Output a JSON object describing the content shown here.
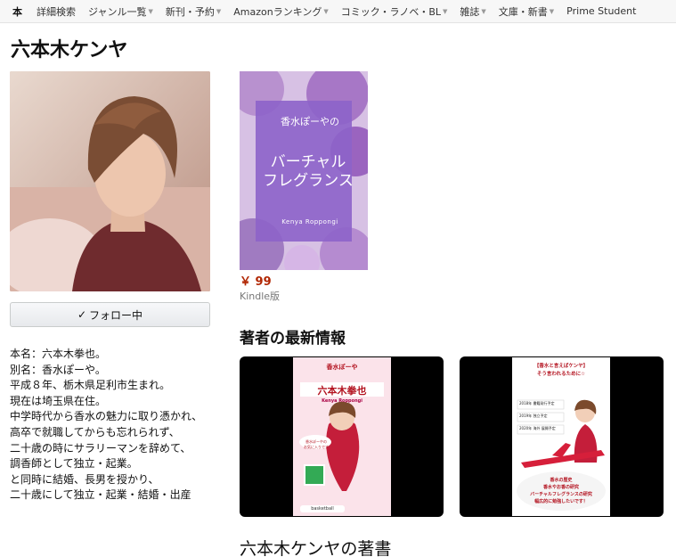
{
  "nav": {
    "items": [
      {
        "label": "本",
        "caret": false
      },
      {
        "label": "詳細検索",
        "caret": false
      },
      {
        "label": "ジャンル一覧",
        "caret": true
      },
      {
        "label": "新刊・予約",
        "caret": true
      },
      {
        "label": "Amazonランキング",
        "caret": true
      },
      {
        "label": "コミック・ラノベ・BL",
        "caret": true
      },
      {
        "label": "雑誌",
        "caret": true
      },
      {
        "label": "文庫・新書",
        "caret": true
      },
      {
        "label": "Prime Student",
        "caret": false
      }
    ]
  },
  "author": {
    "name": "六本木ケンヤ",
    "follow_label": "フォロー中",
    "bio_lines": [
      "本名：六本木拳也。",
      "別名：香水ぽーや。",
      "",
      "平成８年、栃木県足利市生まれ。",
      "現在は埼玉県在住。",
      "",
      "中学時代から香水の魅力に取り憑かれ、",
      "高卒で就職してからも忘れられず、",
      "二十歳の時にサラリーマンを辞めて、",
      "調香師として独立・起業。",
      "",
      "と同時に結婚、長男を授かり、",
      "二十歳にして独立・起業・結婚・出産"
    ]
  },
  "book": {
    "cover_small": "香水ぽーやの",
    "cover_title": "バーチャル\nフレグランス",
    "cover_author": "Kenya Roppongi",
    "price": "￥ 99",
    "format": "Kindle版"
  },
  "news": {
    "heading": "著者の最新情報",
    "cards": [
      {
        "small": "香水ぽーや",
        "large": "六本木拳也",
        "sub": "Kenya Roppongi",
        "bubble": "香水ぽーやの\nお気に入りです",
        "footer": "basketball"
      },
      {
        "top": "【香水と言えばケンヤ】\nそう言われるために☆",
        "lines": [
          "2018年 書籍発行予定",
          "2019年 独立予定",
          "2020年 海外 展開予定"
        ],
        "bottom": "香水の歴史\n香水やお香の研究\nバーチャルフレグランスの研究\n幅広的に勉強したいです！"
      }
    ]
  },
  "books_heading": "六本木ケンヤの著書",
  "colors": {
    "price": "#b12704",
    "accent": "#b3121f"
  }
}
